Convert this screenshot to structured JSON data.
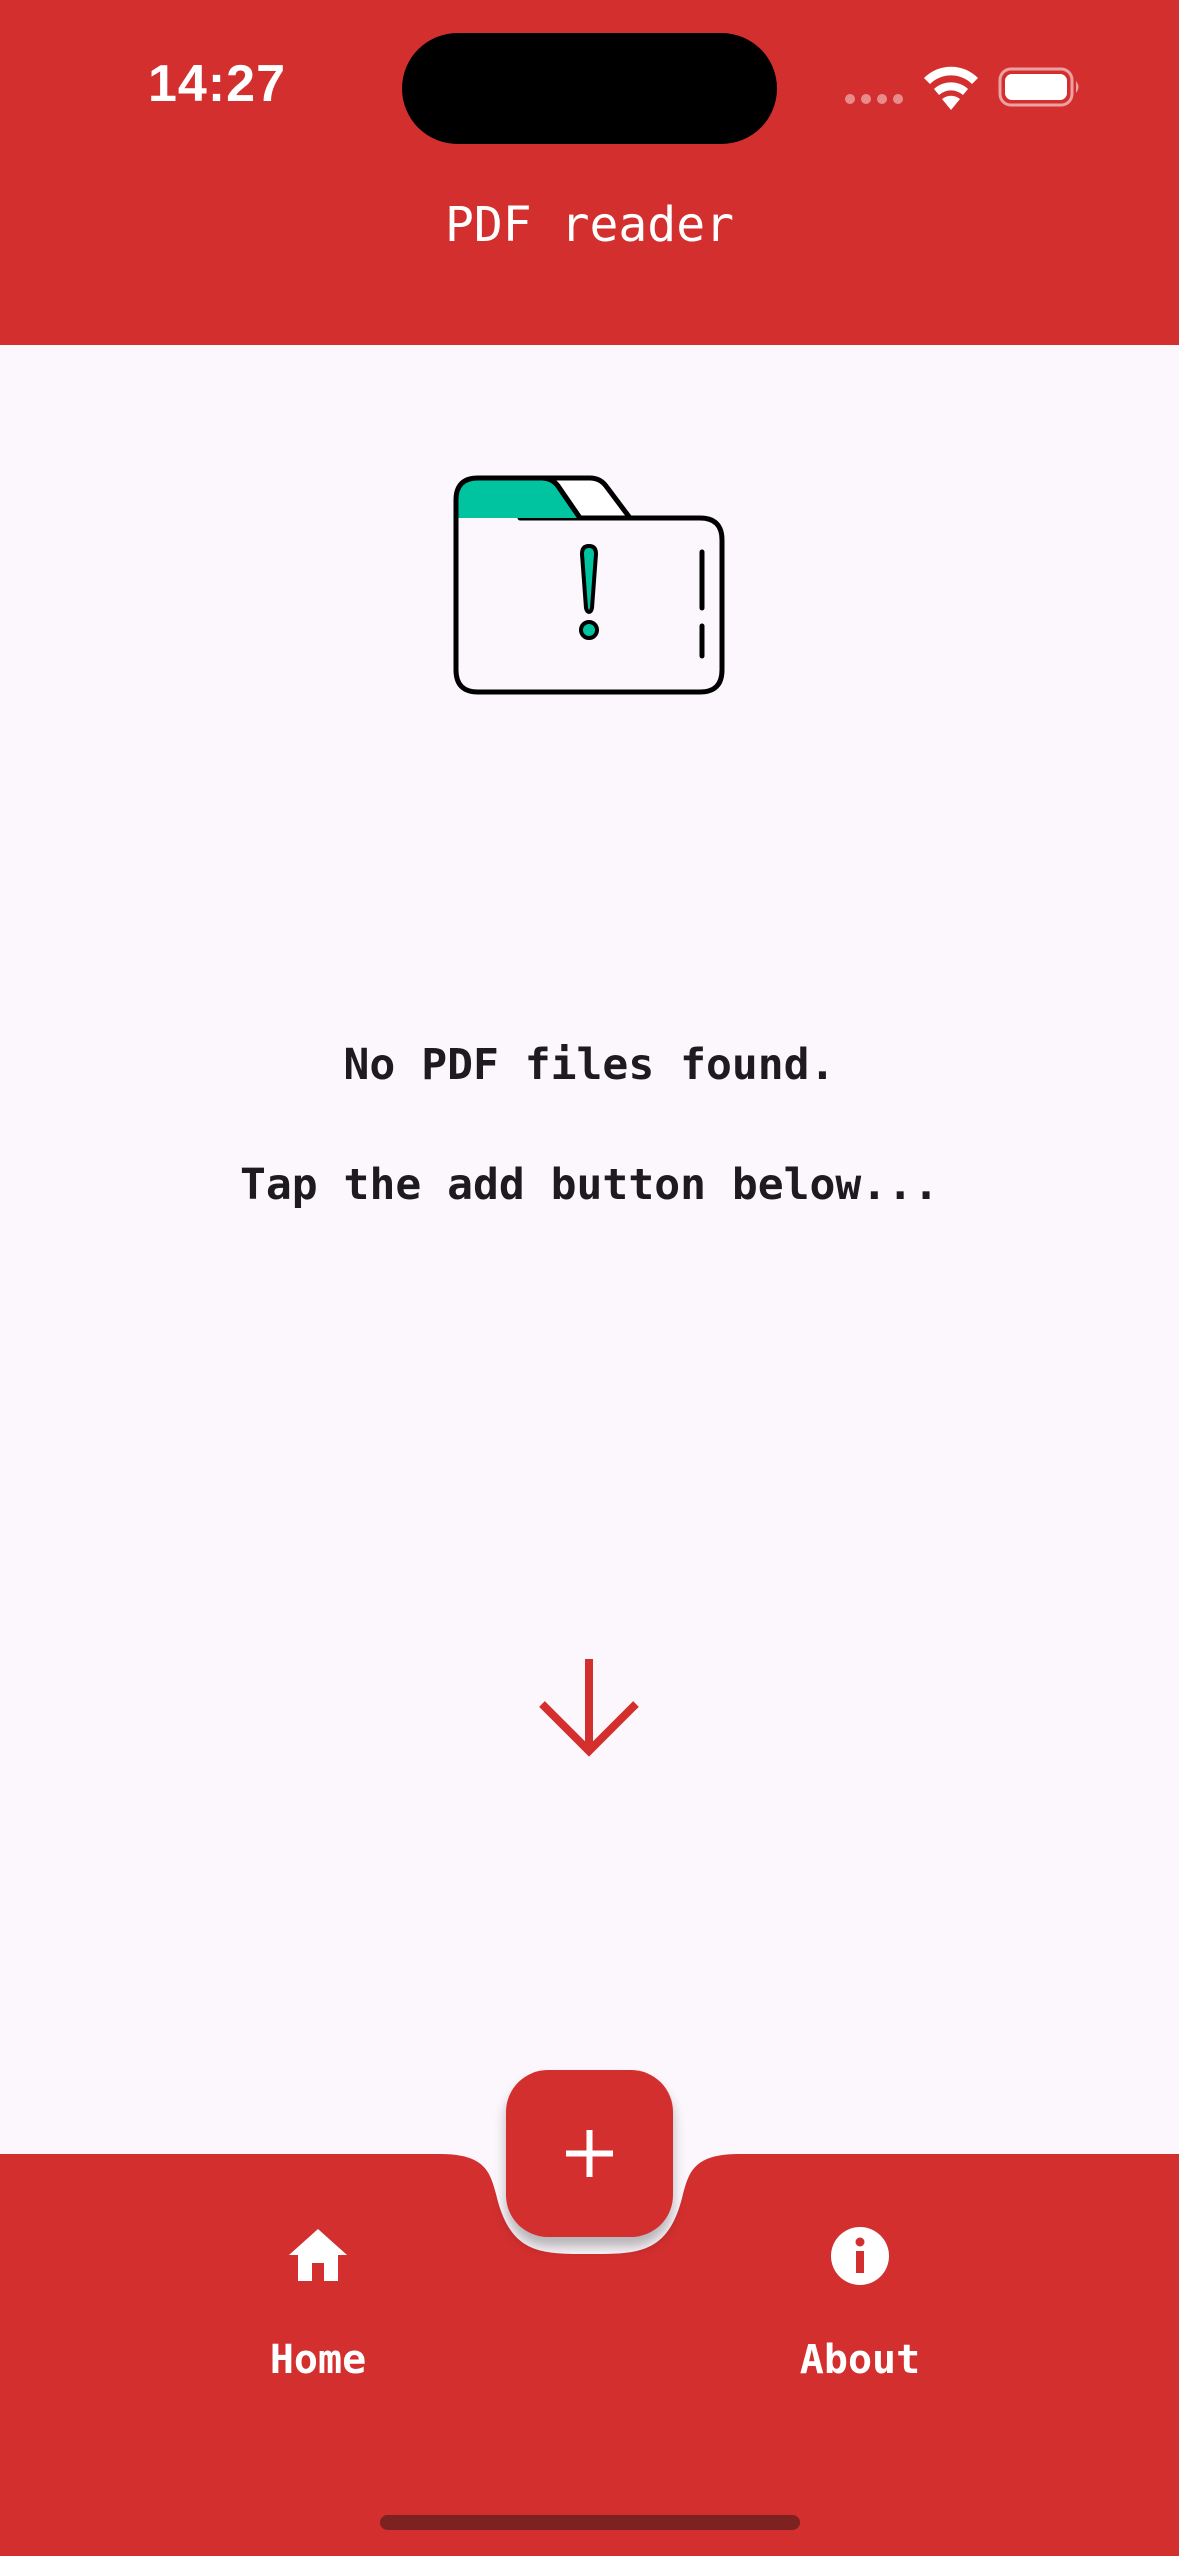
{
  "status_bar": {
    "time": "14:27",
    "icons": [
      "cellular-signal-icon",
      "wifi-icon",
      "battery-icon"
    ]
  },
  "app_bar": {
    "title": "PDF reader"
  },
  "empty_state": {
    "illustration": "folder-warning-icon",
    "line1": "No PDF files found.",
    "line2": "Tap the add button below...",
    "pointer_icon": "arrow-down-icon"
  },
  "fab": {
    "icon": "plus-icon"
  },
  "bottom_nav": {
    "items": [
      {
        "label": "Home",
        "icon": "home-icon"
      },
      {
        "label": "About",
        "icon": "info-icon"
      }
    ]
  },
  "colors": {
    "primary": "#D32F2F",
    "background": "#FCF7FC",
    "text": "#1D1B20",
    "accent": "#00C4A0",
    "on_primary": "#FFFFFF"
  }
}
